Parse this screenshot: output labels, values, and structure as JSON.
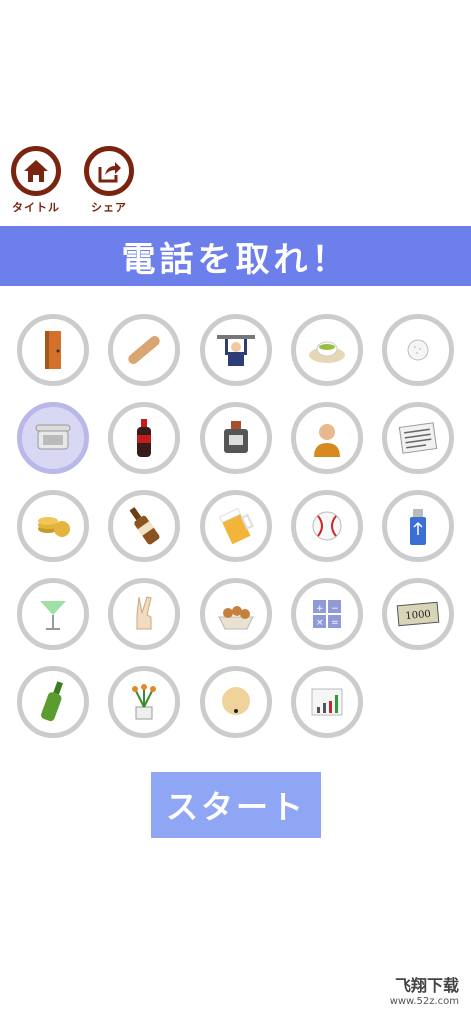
{
  "header": {
    "title_button_label": "タイトル",
    "share_button_label": "シェア"
  },
  "banner": {
    "title": "電話を取れ！"
  },
  "grid": {
    "items": [
      {
        "name": "door-icon"
      },
      {
        "name": "baguette-icon"
      },
      {
        "name": "businessman-hanging-icon"
      },
      {
        "name": "tea-cup-icon"
      },
      {
        "name": "golf-ball-icon"
      },
      {
        "name": "telephone-icon",
        "selected": true
      },
      {
        "name": "cola-bottle-icon"
      },
      {
        "name": "ink-bottle-icon"
      },
      {
        "name": "old-man-icon"
      },
      {
        "name": "newspaper-icon"
      },
      {
        "name": "coins-icon"
      },
      {
        "name": "beer-bottle-icon"
      },
      {
        "name": "beer-mug-icon"
      },
      {
        "name": "baseball-icon"
      },
      {
        "name": "usb-drive-icon"
      },
      {
        "name": "cocktail-icon"
      },
      {
        "name": "peace-hand-icon"
      },
      {
        "name": "takoyaki-icon"
      },
      {
        "name": "calculator-icon"
      },
      {
        "name": "banknote-icon",
        "text": "1000"
      },
      {
        "name": "wine-bottle-icon"
      },
      {
        "name": "flower-pot-icon"
      },
      {
        "name": "bald-head-icon"
      },
      {
        "name": "bar-chart-icon"
      }
    ]
  },
  "start_button": {
    "label": "スタート"
  },
  "watermark": {
    "line1": "飞翔下载",
    "line2": "www.52z.com"
  },
  "colors": {
    "banner": "#6c7fea",
    "start": "#8fa6f5",
    "brown": "#7a2410",
    "ring": "#cccccc"
  }
}
